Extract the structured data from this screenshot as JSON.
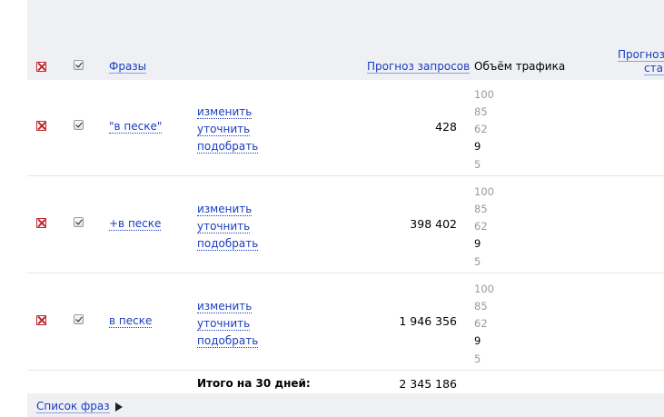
{
  "header": {
    "phrases_label": "Фразы",
    "forecast_label": "Прогноз запросов",
    "traffic_label": "Объём трафика",
    "bid_forecast_line1": "Прогноз с",
    "bid_forecast_line2": "став"
  },
  "rows": [
    {
      "phrase": "\"в песке\"",
      "actions": [
        "изменить",
        "уточнить",
        "подобрать"
      ],
      "forecast": "428",
      "traffic": [
        "100",
        "85",
        "62",
        "9",
        "5"
      ]
    },
    {
      "phrase": "+в песке",
      "actions": [
        "изменить",
        "уточнить",
        "подобрать"
      ],
      "forecast": "398 402",
      "traffic": [
        "100",
        "85",
        "62",
        "9",
        "5"
      ]
    },
    {
      "phrase": "в песке",
      "actions": [
        "изменить",
        "уточнить",
        "подобрать"
      ],
      "forecast": "1 946 356",
      "traffic": [
        "100",
        "85",
        "62",
        "9",
        "5"
      ]
    }
  ],
  "total": {
    "label": "Итого на 30 дней:",
    "value": "2 345 186"
  },
  "footer": {
    "phrase_list_link": "Список фраз"
  },
  "colors": {
    "header_bg": "#eef0f3",
    "link": "#1a3dc1",
    "delete_red": "#c0272d"
  }
}
